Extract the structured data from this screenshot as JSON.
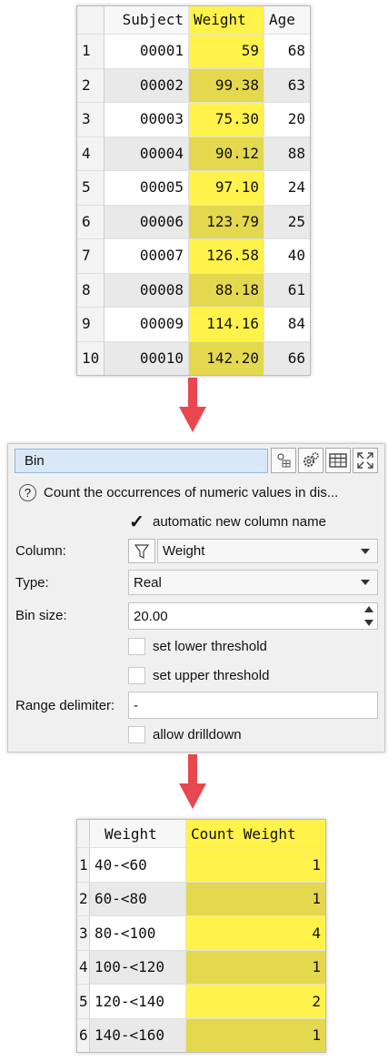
{
  "input_table": {
    "columns": [
      "Subject",
      "Weight",
      "Age"
    ],
    "rows": [
      {
        "idx": "1",
        "subject": "00001",
        "weight": "59",
        "age": "68"
      },
      {
        "idx": "2",
        "subject": "00002",
        "weight": "99.38",
        "age": "63"
      },
      {
        "idx": "3",
        "subject": "00003",
        "weight": "75.30",
        "age": "20"
      },
      {
        "idx": "4",
        "subject": "00004",
        "weight": "90.12",
        "age": "88"
      },
      {
        "idx": "5",
        "subject": "00005",
        "weight": "97.10",
        "age": "24"
      },
      {
        "idx": "6",
        "subject": "00006",
        "weight": "123.79",
        "age": "25"
      },
      {
        "idx": "7",
        "subject": "00007",
        "weight": "126.58",
        "age": "40"
      },
      {
        "idx": "8",
        "subject": "00008",
        "weight": "88.18",
        "age": "61"
      },
      {
        "idx": "9",
        "subject": "00009",
        "weight": "114.16",
        "age": "84"
      },
      {
        "idx": "10",
        "subject": "00010",
        "weight": "142.20",
        "age": "66"
      }
    ]
  },
  "bin_panel": {
    "title": "Bin",
    "description": "Count the occurrences of numeric values in dis...",
    "auto_column_name_label": "automatic new column name",
    "auto_column_name_checked": true,
    "column_label": "Column:",
    "column_value": "Weight",
    "type_label": "Type:",
    "type_value": "Real",
    "bin_size_label": "Bin size:",
    "bin_size_value": "20.00",
    "lower_threshold_label": "set lower threshold",
    "upper_threshold_label": "set upper threshold",
    "range_delimiter_label": "Range delimiter:",
    "range_delimiter_value": "-",
    "drilldown_label": "allow drilldown",
    "toolbar_icons": [
      "column-select-icon",
      "settings-icon",
      "table-icon",
      "maximize-icon"
    ]
  },
  "output_table": {
    "columns": [
      "Weight",
      "Count Weight"
    ],
    "rows": [
      {
        "idx": "1",
        "bin": "40-<60",
        "count": "1"
      },
      {
        "idx": "2",
        "bin": "60-<80",
        "count": "1"
      },
      {
        "idx": "3",
        "bin": "80-<100",
        "count": "4"
      },
      {
        "idx": "4",
        "bin": "100-<120",
        "count": "1"
      },
      {
        "idx": "5",
        "bin": "120-<140",
        "count": "2"
      },
      {
        "idx": "6",
        "bin": "140-<160",
        "count": "1"
      }
    ]
  },
  "colors": {
    "highlight": "#fff24a",
    "highlight_alt": "#e4d84e",
    "arrow": "#e8474f"
  }
}
